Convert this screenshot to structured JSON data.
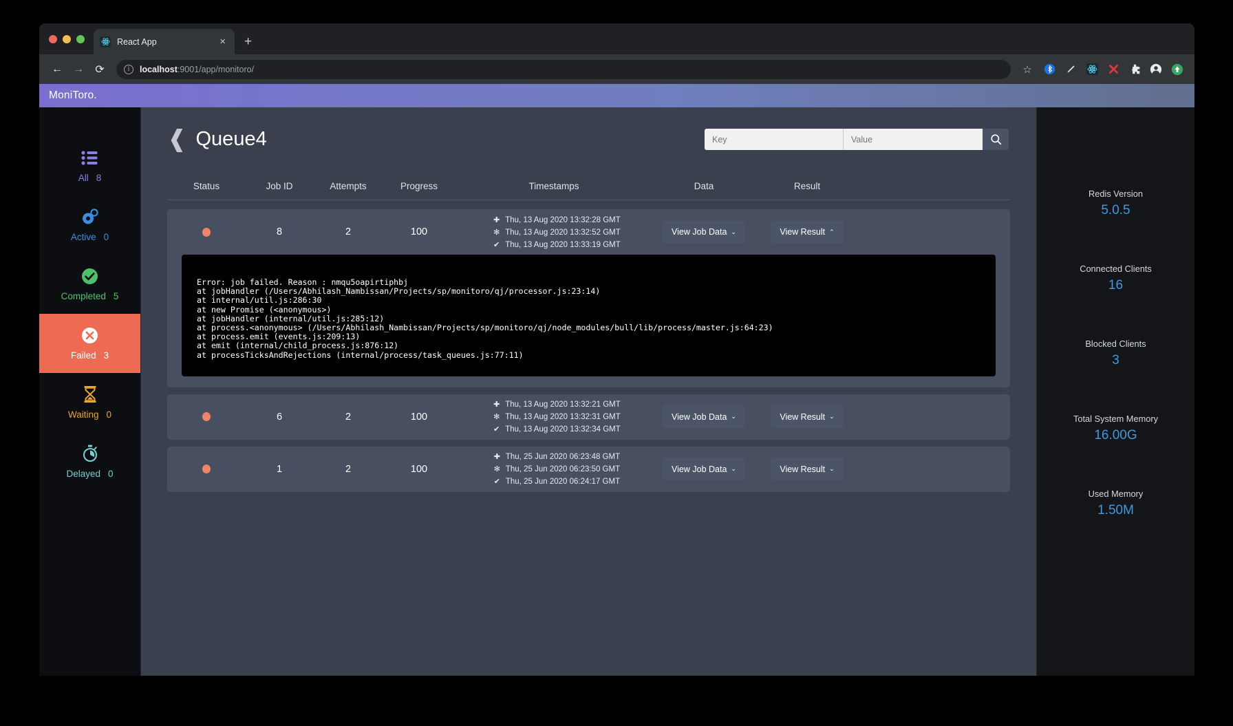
{
  "browser": {
    "tab": {
      "title": "React App",
      "favicon": "react-logo-icon",
      "close": "×"
    },
    "newtab": "+",
    "nav": {
      "back": "←",
      "forward": "→",
      "reload": "⟳"
    },
    "url": {
      "host": "localhost",
      "rest": ":9001/app/monitoro/",
      "info": "i"
    },
    "star": "☆",
    "extensions": [
      "bluetooth-icon",
      "pen-icon",
      "react-devtools-icon",
      "close-x-icon",
      "puzzle-piece-icon",
      "profile-icon",
      "update-icon"
    ]
  },
  "app": {
    "brand": "MoniToro.",
    "page_title": "Queue4",
    "back_chevron": "❰"
  },
  "search": {
    "key_placeholder": "Key",
    "key_value": "",
    "value_placeholder": "Value",
    "value_value": "",
    "button_icon": "search-icon"
  },
  "sidebar": {
    "items": [
      {
        "label": "All",
        "count": "8",
        "icon": "list-icon",
        "color": "#8b7fe0",
        "selected": false
      },
      {
        "label": "Active",
        "count": "0",
        "icon": "gears-icon",
        "color": "#3c8ee0",
        "selected": false
      },
      {
        "label": "Completed",
        "count": "5",
        "icon": "check-circle-icon",
        "color": "#4cc16a",
        "selected": false
      },
      {
        "label": "Failed",
        "count": "3",
        "icon": "x-circle-icon",
        "color": "#ffffff",
        "selected": true
      },
      {
        "label": "Waiting",
        "count": "0",
        "icon": "hourglass-icon",
        "color": "#e9a62e",
        "selected": false
      },
      {
        "label": "Delayed",
        "count": "0",
        "icon": "stopwatch-icon",
        "color": "#74cfd2",
        "selected": false
      }
    ],
    "selected_bg": "#ec6b52"
  },
  "table": {
    "columns": [
      "Status",
      "Job ID",
      "Attempts",
      "Progress",
      "Timestamps",
      "Data",
      "Result"
    ],
    "view_job_data_label": "View Job Data",
    "view_result_label": "View Result",
    "chevron_down": "⌄",
    "chevron_up": "⌃",
    "status_color": "#f08368",
    "icons": {
      "created": "✚",
      "processed": "✻",
      "finished": "✔"
    },
    "rows": [
      {
        "status": "failed",
        "job_id": "8",
        "attempts": "2",
        "progress": "100",
        "timestamps": [
          "Thu, 13 Aug 2020 13:32:28 GMT",
          "Thu, 13 Aug 2020 13:32:52 GMT",
          "Thu, 13 Aug 2020 13:33:19 GMT"
        ],
        "result_expanded": true,
        "log": "Error: job failed. Reason : nmqu5oapirtiphbj\nat jobHandler (/Users/Abhilash_Nambissan/Projects/sp/monitoro/qj/processor.js:23:14)\nat internal/util.js:286:30\nat new Promise (<anonymous>)\nat jobHandler (internal/util.js:285:12)\nat process.<anonymous> (/Users/Abhilash_Nambissan/Projects/sp/monitoro/qj/node_modules/bull/lib/process/master.js:64:23)\nat process.emit (events.js:209:13)\nat emit (internal/child_process.js:876:12)\nat processTicksAndRejections (internal/process/task_queues.js:77:11)"
      },
      {
        "status": "failed",
        "job_id": "6",
        "attempts": "2",
        "progress": "100",
        "timestamps": [
          "Thu, 13 Aug 2020 13:32:21 GMT",
          "Thu, 13 Aug 2020 13:32:31 GMT",
          "Thu, 13 Aug 2020 13:32:34 GMT"
        ],
        "result_expanded": false,
        "log": ""
      },
      {
        "status": "failed",
        "job_id": "1",
        "attempts": "2",
        "progress": "100",
        "timestamps": [
          "Thu, 25 Jun 2020 06:23:48 GMT",
          "Thu, 25 Jun 2020 06:23:50 GMT",
          "Thu, 25 Jun 2020 06:24:17 GMT"
        ],
        "result_expanded": false,
        "log": ""
      }
    ]
  },
  "stats": {
    "accent": "#3c9be0",
    "items": [
      {
        "label": "Redis Version",
        "value": "5.0.5"
      },
      {
        "label": "Connected Clients",
        "value": "16"
      },
      {
        "label": "Blocked Clients",
        "value": "3"
      },
      {
        "label": "Total System Memory",
        "value": "16.00G"
      },
      {
        "label": "Used Memory",
        "value": "1.50M"
      }
    ]
  }
}
